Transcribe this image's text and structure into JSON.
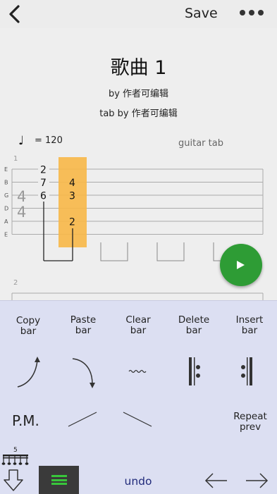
{
  "toolbar": {
    "save_label": "Save"
  },
  "song": {
    "title": "歌曲 1",
    "author": "by 作者可编辑",
    "tab_by": "tab by 作者可编辑",
    "tempo": "= 120",
    "track": "guitar tab"
  },
  "tab": {
    "bar1_number": "1",
    "bar2_number": "2",
    "strings": [
      "E",
      "B",
      "G",
      "D",
      "A",
      "E"
    ],
    "time_signature": {
      "top": "4",
      "bottom": "4"
    },
    "beat1": {
      "B_high_e": "2",
      "B": "7",
      "G": "6"
    },
    "beat2": {
      "B": "4",
      "G": "3",
      "A": "2"
    },
    "highlight_color": "#f7b84b"
  },
  "actions": {
    "copy_bar": [
      "Copy",
      "bar"
    ],
    "paste_bar": [
      "Paste",
      "bar"
    ],
    "clear_bar": [
      "Clear",
      "bar"
    ],
    "delete_bar": [
      "Delete",
      "bar"
    ],
    "insert_bar": [
      "Insert",
      "bar"
    ],
    "pm": "P.M.",
    "repeat_prev": [
      "Repeat",
      "prev"
    ],
    "tuplet": "5",
    "undo": "undo"
  },
  "colors": {
    "play": "#2e9c35",
    "panel": "#dcdff2",
    "menu_accent": "#38c63b",
    "undo": "#202a7a"
  }
}
